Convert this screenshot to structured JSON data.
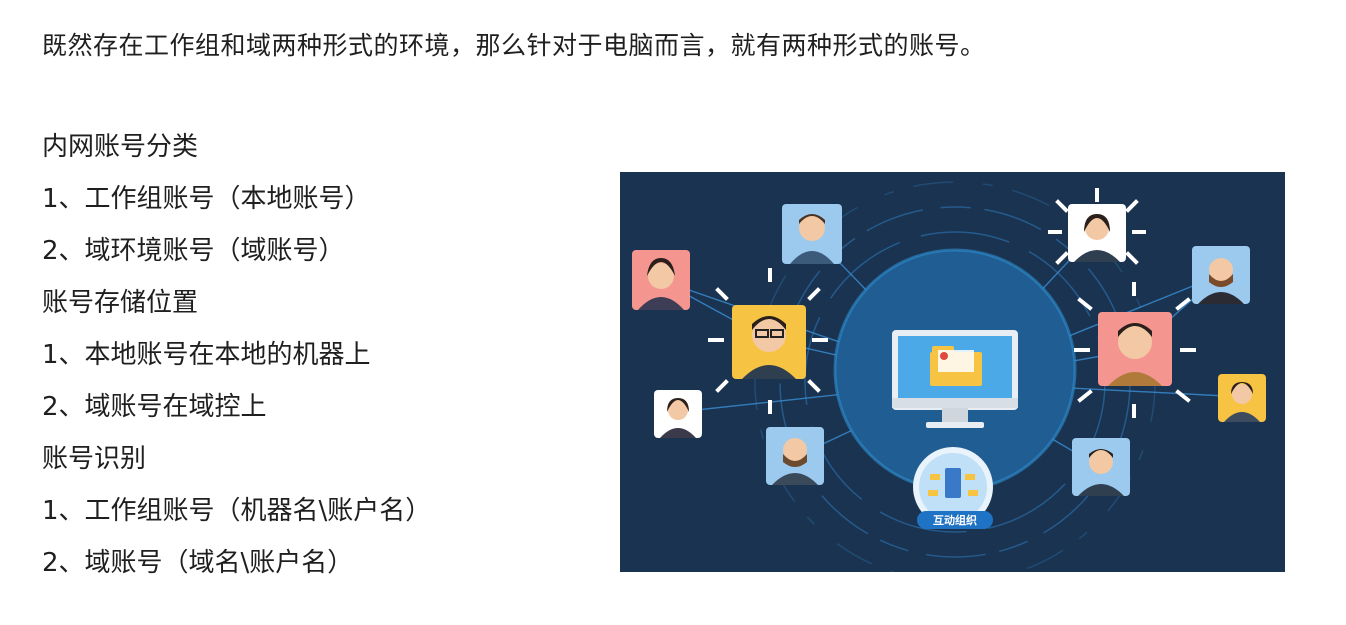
{
  "intro": "既然存在工作组和域两种形式的环境，那么针对于电脑而言，就有两种形式的账号。",
  "lines": [
    {
      "kind": "heading",
      "text": "内网账号分类"
    },
    {
      "kind": "item",
      "text": "1、工作组账号（本地账号）"
    },
    {
      "kind": "item",
      "text": "2、域环境账号（域账号）"
    },
    {
      "kind": "heading",
      "text": "账号存储位置"
    },
    {
      "kind": "item",
      "text": "1、本地账号在本地的机器上"
    },
    {
      "kind": "item",
      "text": "2、域账号在域控上"
    },
    {
      "kind": "heading",
      "text": "账号识别"
    },
    {
      "kind": "item",
      "text": "1、工作组账号（机器名\\账户名）"
    },
    {
      "kind": "item",
      "text": "2、域账号（域名\\账户名）"
    }
  ],
  "illustration": {
    "badge_label": "互动组织",
    "colors": {
      "background": "#1a3350",
      "globe": "#1f5d93",
      "glow": "#2e8fd0",
      "accent_yellow": "#f6c343",
      "accent_pink": "#f4958f",
      "accent_blue": "#9cc9ee"
    }
  }
}
